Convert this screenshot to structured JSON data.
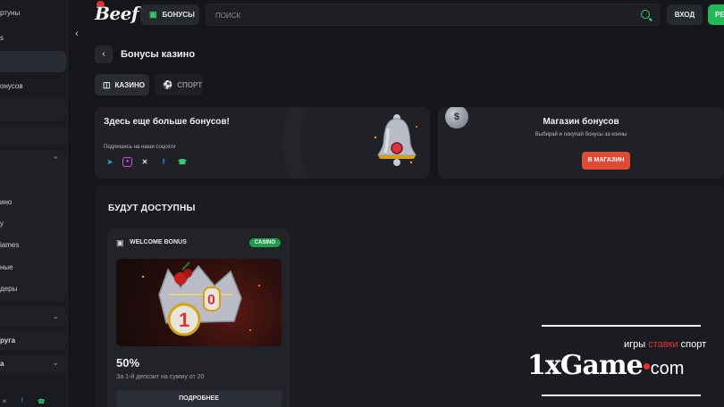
{
  "sidebar": {
    "items": [
      {
        "label": "ртуны"
      },
      {
        "label": "s"
      },
      {
        "label": ""
      },
      {
        "label": "онусов"
      },
      {
        "label": "ино"
      },
      {
        "label": "у"
      },
      {
        "label": "iames"
      },
      {
        "label": "ные"
      },
      {
        "label": "деры"
      },
      {
        "label": "руга"
      },
      {
        "label": "а"
      }
    ]
  },
  "header": {
    "logo": "Beef",
    "bonus_button": "БОНУСЫ",
    "search_placeholder": "ПОИСК",
    "login_button": "ВХОД",
    "register_button": "РЕ"
  },
  "page": {
    "title": "Бонусы казино",
    "tabs": [
      {
        "label": "КАЗИНО"
      },
      {
        "label": "СПОРТ"
      }
    ]
  },
  "promo_left": {
    "title": "Здесь еще больше бонусов!",
    "subtitle": "Подпишись на наши соцсети"
  },
  "promo_right": {
    "coin": "$",
    "title": "Магазин бонусов",
    "subtitle": "Выбирай и покупай бонусы за коины",
    "button": "В МАГАЗИН"
  },
  "upcoming": {
    "title": "БУДУТ ДОСТУПНЫ",
    "cards": [
      {
        "title": "WELCOME BONUS",
        "tag": "CASINO",
        "value": "50%",
        "description": "За 1-й депозит на сумму от 20",
        "button": "ПОДРОБНЕЕ"
      }
    ]
  },
  "watermark": {
    "tagline_1": "игры",
    "tagline_2": "ставки",
    "tagline_3": "спорт",
    "logo_a": "1x",
    "logo_b": "Game",
    "logo_c": "com"
  },
  "colors": {
    "accent_green": "#22b857",
    "shop_button": "#df4b35",
    "background": "#15161a"
  }
}
